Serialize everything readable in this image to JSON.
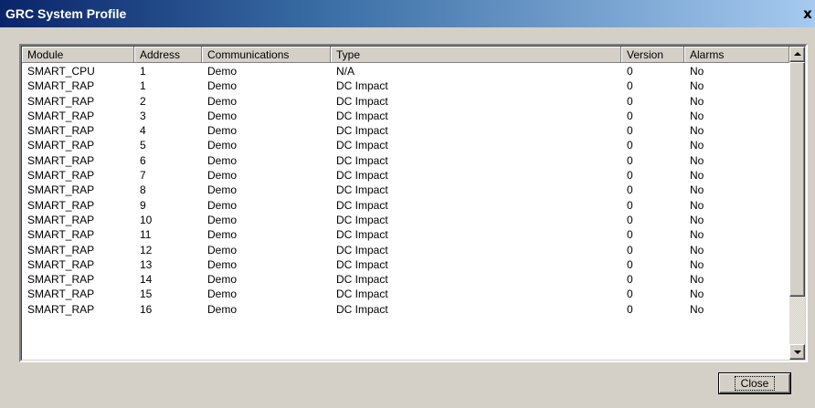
{
  "window": {
    "title": "GRC System Profile",
    "close_glyph": "x"
  },
  "table": {
    "columns": [
      "Module",
      "Address",
      "Communications",
      "Type",
      "Version",
      "Alarms"
    ],
    "rows": [
      [
        "SMART_CPU",
        "1",
        "Demo",
        "N/A",
        "0",
        "No"
      ],
      [
        "SMART_RAP",
        "1",
        "Demo",
        "DC Impact",
        "0",
        "No"
      ],
      [
        "SMART_RAP",
        "2",
        "Demo",
        "DC Impact",
        "0",
        "No"
      ],
      [
        "SMART_RAP",
        "3",
        "Demo",
        "DC Impact",
        "0",
        "No"
      ],
      [
        "SMART_RAP",
        "4",
        "Demo",
        "DC Impact",
        "0",
        "No"
      ],
      [
        "SMART_RAP",
        "5",
        "Demo",
        "DC Impact",
        "0",
        "No"
      ],
      [
        "SMART_RAP",
        "6",
        "Demo",
        "DC Impact",
        "0",
        "No"
      ],
      [
        "SMART_RAP",
        "7",
        "Demo",
        "DC Impact",
        "0",
        "No"
      ],
      [
        "SMART_RAP",
        "8",
        "Demo",
        "DC Impact",
        "0",
        "No"
      ],
      [
        "SMART_RAP",
        "9",
        "Demo",
        "DC Impact",
        "0",
        "No"
      ],
      [
        "SMART_RAP",
        "10",
        "Demo",
        "DC Impact",
        "0",
        "No"
      ],
      [
        "SMART_RAP",
        "11",
        "Demo",
        "DC Impact",
        "0",
        "No"
      ],
      [
        "SMART_RAP",
        "12",
        "Demo",
        "DC Impact",
        "0",
        "No"
      ],
      [
        "SMART_RAP",
        "13",
        "Demo",
        "DC Impact",
        "0",
        "No"
      ],
      [
        "SMART_RAP",
        "14",
        "Demo",
        "DC Impact",
        "0",
        "No"
      ],
      [
        "SMART_RAP",
        "15",
        "Demo",
        "DC Impact",
        "0",
        "No"
      ],
      [
        "SMART_RAP",
        "16",
        "Demo",
        "DC Impact",
        "0",
        "No"
      ]
    ]
  },
  "buttons": {
    "close_label": "Close"
  },
  "colors": {
    "title_gradient_start": "#0a246a",
    "title_gradient_end": "#a6caf0",
    "dialog_face": "#d4d0c8"
  }
}
